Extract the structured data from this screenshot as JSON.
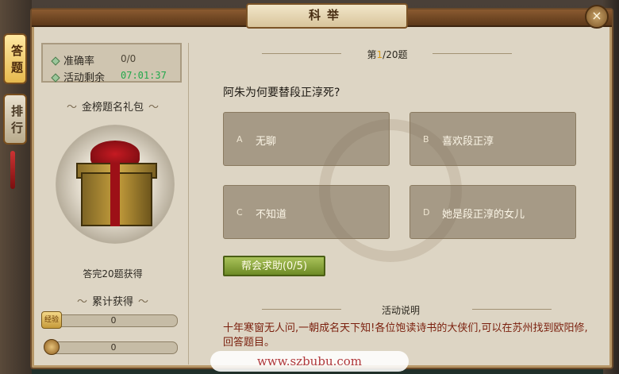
{
  "window": {
    "title": "科举",
    "close_label": "×"
  },
  "side_tabs": [
    {
      "label": "答题",
      "active": true
    },
    {
      "label": "排行",
      "active": false
    }
  ],
  "stats": {
    "accuracy_label": "准确率",
    "accuracy_value": "0/0",
    "remaining_label": "活动剩余",
    "remaining_value": "07:01:37"
  },
  "gift": {
    "title": "金榜题名礼包",
    "caption": "答完20题获得"
  },
  "accumulated": {
    "title": "累计获得",
    "experience_value": "0",
    "experience_icon_label": "经验",
    "coin_value": "0",
    "experience_icon": "scroll-icon",
    "coin_icon": "coin-icon"
  },
  "question": {
    "counter_prefix": "第",
    "counter_current": "1",
    "counter_suffix": "/20题",
    "text": "阿朱为何要替段正淳死?",
    "options": [
      {
        "letter": "A",
        "text": "无聊"
      },
      {
        "letter": "B",
        "text": "喜欢段正淳"
      },
      {
        "letter": "C",
        "text": "不知道"
      },
      {
        "letter": "D",
        "text": "她是段正淳的女儿"
      }
    ],
    "help_button": "帮会求助(0/5)"
  },
  "description": {
    "title": "活动说明",
    "text": "十年寒窗无人问,一朝成名天下知!各位饱读诗书的大侠们,可以在苏州找到欧阳修,回答题目。"
  },
  "watermark": "www.szbubu.com",
  "colors": {
    "accent": "#22a84b",
    "text_red": "#7a1f0d",
    "frame": "#ddd5c4"
  }
}
